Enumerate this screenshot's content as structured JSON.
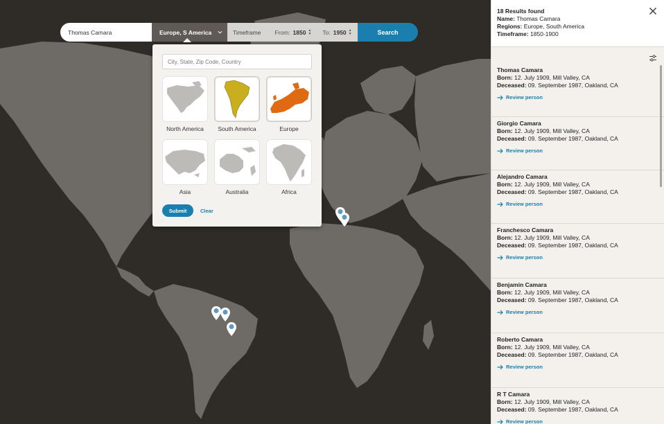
{
  "search": {
    "name_value": "Thomas Camara",
    "region_value": "Europe, S America",
    "timeframe_label": "Timeframe",
    "from_label": "From:",
    "from_value": "1850",
    "to_label": "To:",
    "to_value": "1950",
    "search_label": "Search"
  },
  "region_panel": {
    "placeholder": "City, State, Zip Code, Country",
    "regions": [
      {
        "label": "North America",
        "selected": false
      },
      {
        "label": "South America",
        "selected": true
      },
      {
        "label": "Europe",
        "selected": true
      },
      {
        "label": "Asia",
        "selected": false
      },
      {
        "label": "Australia",
        "selected": false
      },
      {
        "label": "Africa",
        "selected": false
      }
    ],
    "submit_label": "Submit",
    "clear_label": "Clear"
  },
  "results": {
    "count_text": "18 Results found",
    "name_label": "Name:",
    "name_value": "Thomas Camara",
    "regions_label": "Regions:",
    "regions_value": "Europe, South America",
    "timeframe_label": "Timeframe:",
    "timeframe_value": "1850-1900",
    "born_label": "Born:",
    "deceased_label": "Deceased:",
    "review_label": "Review person",
    "items": [
      {
        "name": "Thomas Camara",
        "born": "12. July 1909, Mill Valley, CA",
        "deceased": "09. September 1987, Oakland, CA"
      },
      {
        "name": "Giorgio Camara",
        "born": "12. July 1909, Mill Valley, CA",
        "deceased": "09. September 1987, Oakland, CA"
      },
      {
        "name": "Alejandro Camara",
        "born": "12. July 1909, Mill Valley, CA",
        "deceased": "09. September 1987, Oakland, CA"
      },
      {
        "name": "Franchesco Camara",
        "born": "12. July 1909, Mill Valley, CA",
        "deceased": "09. September 1987, Oakland, CA"
      },
      {
        "name": "Benjamin Camara",
        "born": "12. July 1909, Mill Valley, CA",
        "deceased": "09. September 1987, Oakland, CA"
      },
      {
        "name": "Roberto Camara",
        "born": "12. July 1909, Mill Valley, CA",
        "deceased": "09. September 1987, Oakland, CA"
      },
      {
        "name": "R T Camara",
        "born": "12. July 1909, Mill Valley, CA",
        "deceased": "09. September 1987, Oakland, CA"
      }
    ]
  },
  "colors": {
    "map_background": "#2f2b26",
    "land": "#6e6a65",
    "accent": "#1a7fae",
    "selected_region_south_america": "#c9ae1e",
    "selected_region_europe": "#e06a12",
    "sidebar_background": "#f4f1ec"
  },
  "icons": [
    "chevron-down-icon",
    "up-down-arrows-icon",
    "close-icon",
    "filter-sliders-icon",
    "arrow-right-icon",
    "map-pin-icon"
  ]
}
